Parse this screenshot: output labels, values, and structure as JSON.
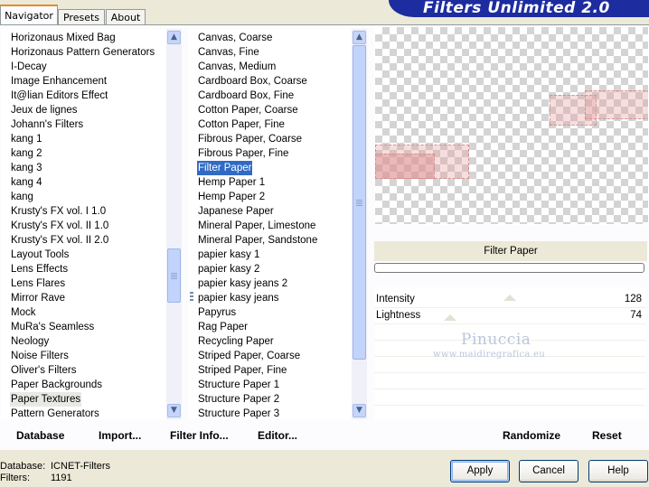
{
  "tabs": [
    {
      "label": "Navigator",
      "active": true
    },
    {
      "label": "Presets",
      "active": false
    },
    {
      "label": "About",
      "active": false
    }
  ],
  "app_title": "Filters Unlimited 2.0",
  "categories": [
    "Horizonaus Mixed Bag",
    "Horizonaus Pattern Generators",
    "I-Decay",
    "Image Enhancement",
    "It@lian Editors Effect",
    "Jeux de lignes",
    "Johann's Filters",
    "kang 1",
    "kang 2",
    "kang 3",
    "kang 4",
    "kang",
    "Krusty's FX vol. I 1.0",
    "Krusty's FX vol. II 1.0",
    "Krusty's FX vol. II 2.0",
    "Layout Tools",
    "Lens Effects",
    "Lens Flares",
    "Mirror Rave",
    "Mock",
    "MuRa's Seamless",
    "Neology",
    "Noise Filters",
    "Oliver's Filters",
    "Paper Backgrounds",
    "Paper Textures",
    "Pattern Generators"
  ],
  "selected_category": "Paper Textures",
  "filters": [
    "Canvas, Coarse",
    "Canvas, Fine",
    "Canvas, Medium",
    "Cardboard Box, Coarse",
    "Cardboard Box, Fine",
    "Cotton Paper, Coarse",
    "Cotton Paper, Fine",
    "Fibrous Paper, Coarse",
    "Fibrous Paper, Fine",
    "Filter Paper",
    "Hemp Paper 1",
    "Hemp Paper 2",
    "Japanese Paper",
    "Mineral Paper, Limestone",
    "Mineral Paper, Sandstone",
    "papier kasy 1",
    "papier kasy 2",
    "papier kasy jeans 2",
    "papier kasy jeans",
    "Papyrus",
    "Rag Paper",
    "Recycling Paper",
    "Striped Paper, Coarse",
    "Striped Paper, Fine",
    "Structure Paper 1",
    "Structure Paper 2",
    "Structure Paper 3"
  ],
  "selected_filter": "Filter Paper",
  "current_filter_name": "Filter Paper",
  "parameters": [
    {
      "label": "Intensity",
      "value": "128"
    },
    {
      "label": "Lightness",
      "value": "74"
    }
  ],
  "watermark": {
    "name": "Pinuccia",
    "url": "www.maidiregrafica.eu"
  },
  "toolbar": {
    "database": "Database",
    "import": "Import...",
    "filter_info": "Filter Info...",
    "editor": "Editor...",
    "randomize": "Randomize",
    "reset": "Reset"
  },
  "status": {
    "database_label": "Database:",
    "database_value": "ICNET-Filters",
    "filters_label": "Filters:",
    "filters_value": "1191"
  },
  "buttons": {
    "apply": "Apply",
    "cancel": "Cancel",
    "help": "Help"
  },
  "colors": {
    "accent": "#316ac5",
    "banner": "#1d2c9e",
    "tab_highlight": "#e68b2c"
  }
}
